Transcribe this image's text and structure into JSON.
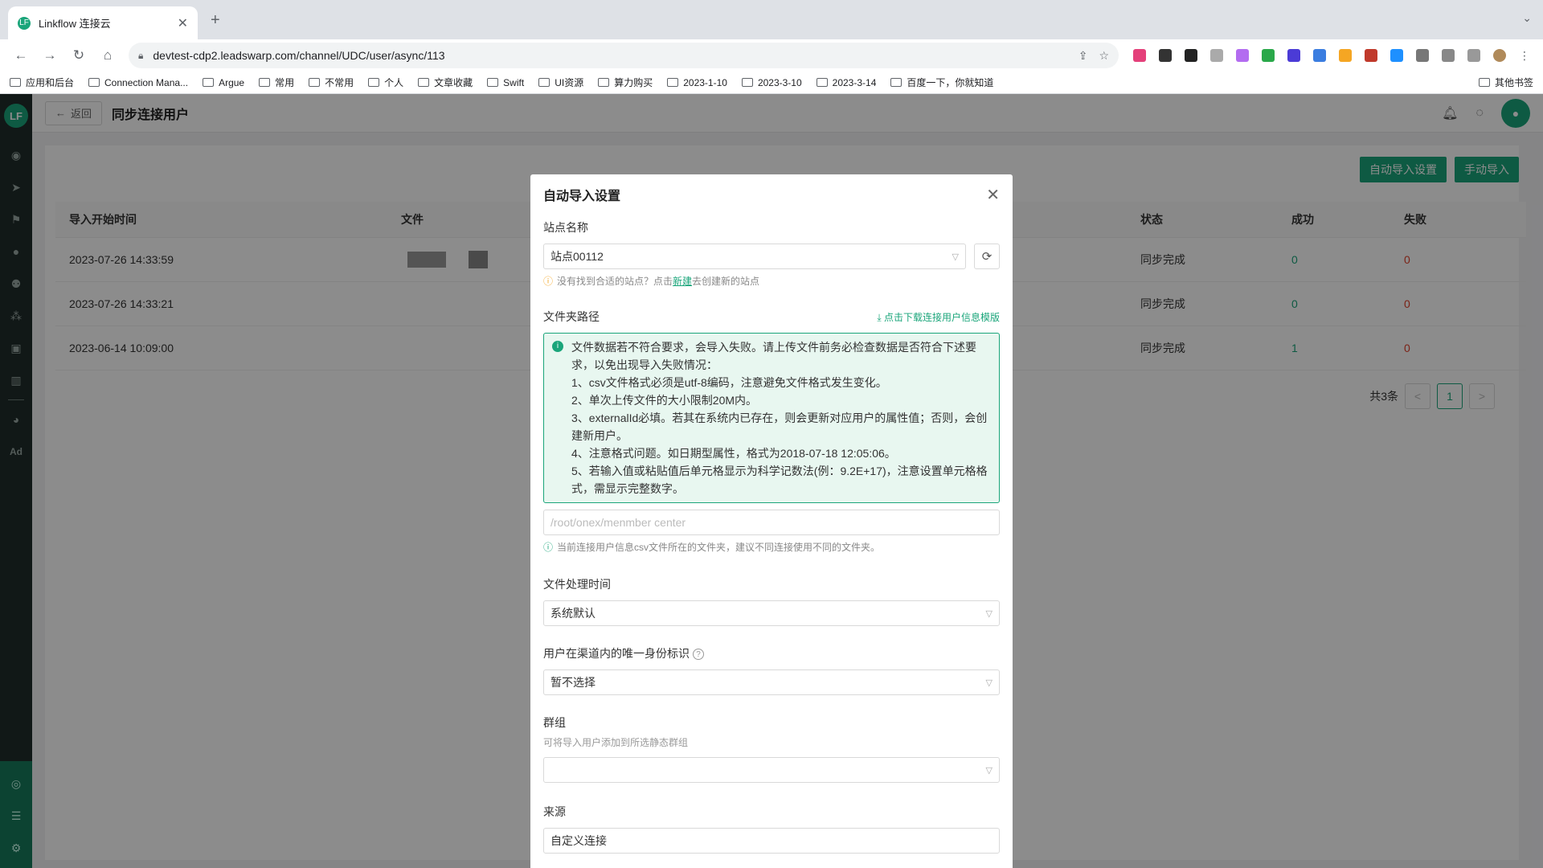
{
  "browser": {
    "tab_title": "Linkflow 连接云",
    "tab_favicon": "LF",
    "url": "devtest-cdp2.leadswarp.com/channel/UDC/user/async/113",
    "bookmarks": [
      "应用和后台",
      "Connection Mana...",
      "Argue",
      "常用",
      "不常用",
      "个人",
      "文章收藏",
      "Swift",
      "UI资源",
      "算力购买",
      "2023-1-10",
      "2023-3-10",
      "2023-3-14",
      "百度一下，你就知道"
    ],
    "other_bookmarks": "其他书签"
  },
  "app": {
    "logo": "LF",
    "back_label": "返回",
    "page_title": "同步连接用户",
    "auto_import_btn": "自动导入设置",
    "manual_import_btn": "手动导入",
    "table": {
      "headers": [
        "导入开始时间",
        "文件",
        "状态",
        "成功",
        "失败"
      ],
      "rows": [
        {
          "time": "2023-07-26 14:33:59",
          "status": "同步完成",
          "success": "0",
          "fail": "0"
        },
        {
          "time": "2023-07-26 14:33:21",
          "status": "同步完成",
          "success": "0",
          "fail": "0"
        },
        {
          "time": "2023-06-14 10:09:00",
          "status": "同步完成",
          "success": "1",
          "fail": "0"
        }
      ]
    },
    "pager": {
      "total": "共3条",
      "current": "1",
      "prev": "<",
      "next": ">"
    }
  },
  "modal": {
    "title": "自动导入设置",
    "site_label": "站点名称",
    "site_value": "站点00112",
    "site_hint_pre": "没有找到合适的站点？点击",
    "site_hint_link": "新建",
    "site_hint_post": "去创建新的站点",
    "folder_label": "文件夹路径",
    "download_link": "点击下载连接用户信息模版",
    "alert_lines": [
      "文件数据若不符合要求，会导入失败。请上传文件前务必检查数据是否符合下述要求，以免出现导入失败情况：",
      "1、csv文件格式必须是utf-8编码，注意避免文件格式发生变化。",
      "2、单次上传文件的大小限制20M内。",
      "3、externalId必填。若其在系统内已存在，则会更新对应用户的属性值；否则，会创建新用户。",
      "4、注意格式问题。如日期型属性，格式为2018-07-18 12:05:06。",
      "5、若输入值或粘贴值后单元格显示为科学记数法(例：9.2E+17)，注意设置单元格格式，需显示完整数字。"
    ],
    "folder_placeholder": "/root/onex/menmber center",
    "folder_hint": "当前连接用户信息csv文件所在的文件夹，建议不同连接使用不同的文件夹。",
    "time_label": "文件处理时间",
    "time_value": "系统默认",
    "identity_label": "用户在渠道内的唯一身份标识",
    "identity_value": "暂不选择",
    "group_label": "群组",
    "group_sub": "可将导入用户添加到所选静态群组",
    "group_value": "",
    "source_label": "来源",
    "source_value": "自定义连接"
  }
}
